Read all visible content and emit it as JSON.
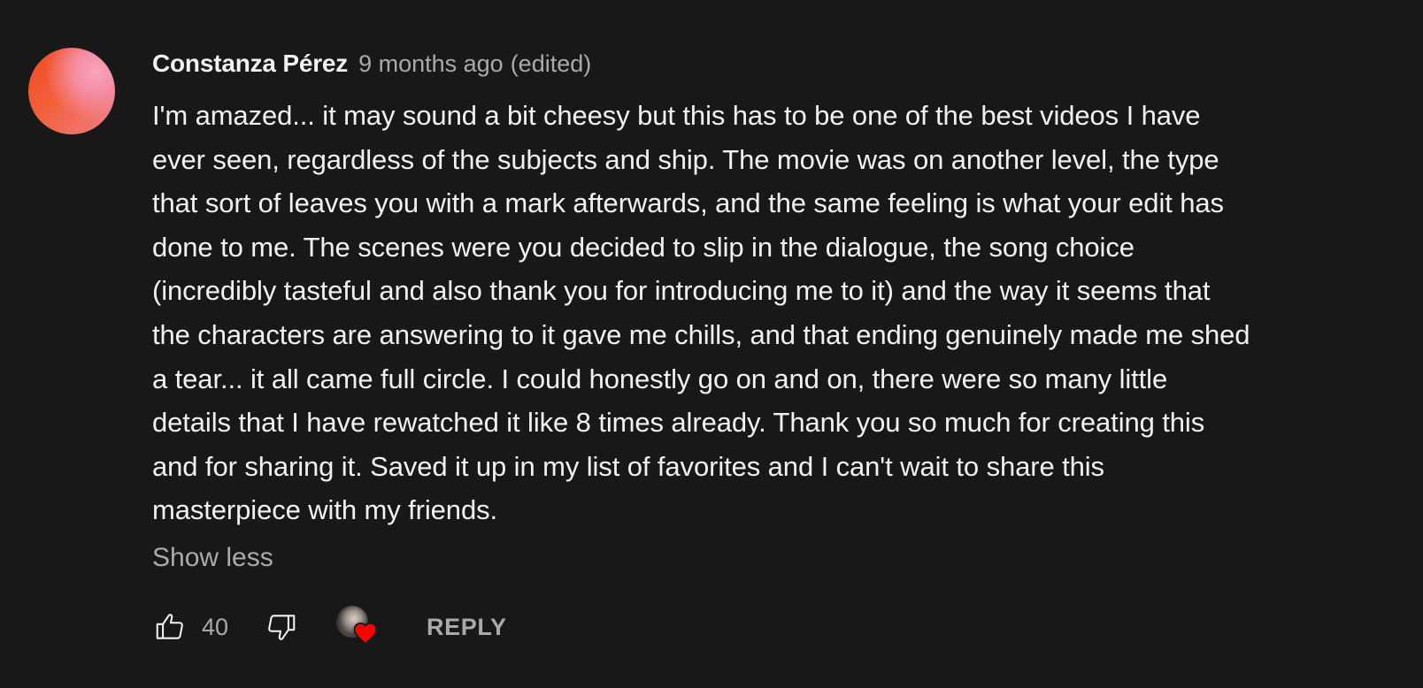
{
  "comment": {
    "author": "Constanza Pérez",
    "time": "9 months ago",
    "edited": "(edited)",
    "text": "I'm amazed... it may sound a bit cheesy but this has to be one of the best videos I have\never seen, regardless of the subjects and ship. The movie was on another level, the type\nthat sort of leaves you with a mark afterwards, and the same feeling is what your edit has\ndone to me. The scenes were you decided to slip in the dialogue, the song choice\n(incredibly tasteful and also thank you for introducing me to it) and the way it seems that\nthe characters are answering to it gave me chills, and that ending genuinely made me shed\na tear... it all came full circle. I could honestly go on and on, there were so many little\ndetails that I have rewatched it like 8 times already. Thank you so much for creating this\nand for sharing it. Saved it up in my list of favorites and I can't wait to share this\nmasterpiece with my friends.",
    "show_less": "Show less",
    "like_count": "40",
    "reply_label": "REPLY"
  },
  "icons": {
    "like": "thumbs-up-icon",
    "dislike": "thumbs-down-icon",
    "creator_heart": "creator-heart-icon"
  },
  "colors": {
    "background": "#181818",
    "primary_text": "#f1f1f1",
    "secondary_text": "#aaaaaa",
    "heart": "#ff0000"
  }
}
